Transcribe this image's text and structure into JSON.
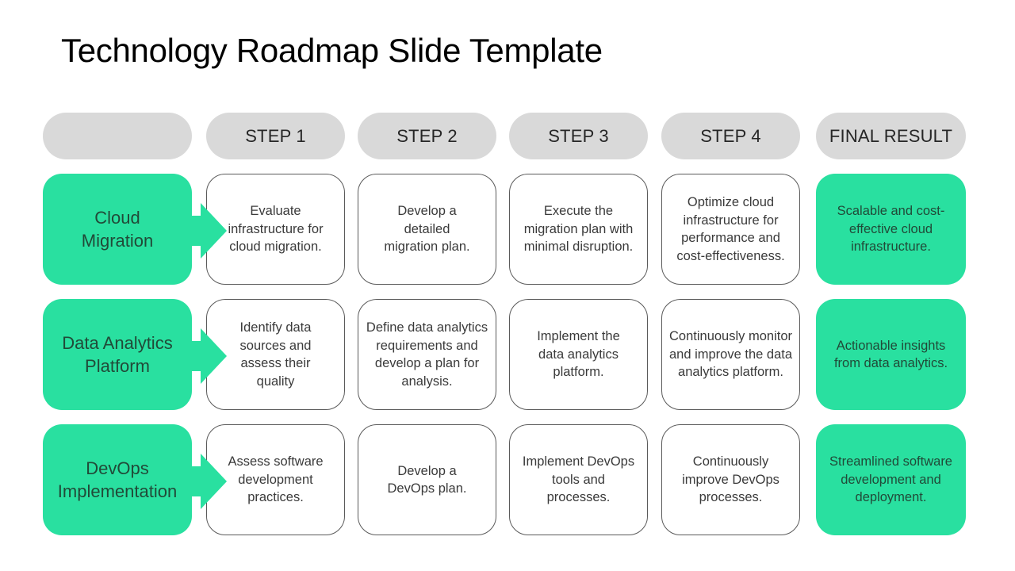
{
  "slide": {
    "title": "Technology Roadmap Slide Template"
  },
  "header": {
    "columns": [
      "",
      "STEP 1",
      "STEP 2",
      "STEP 3",
      "STEP 4",
      "FINAL RESULT"
    ]
  },
  "colors": {
    "accent_green": "#29e0a0",
    "header_gray": "#d9d9d9",
    "border_gray": "#5a5a5a"
  },
  "rows": [
    {
      "category": "Cloud Migration",
      "steps": [
        "Evaluate infrastructure for cloud migration.",
        "Develop a detailed migration plan.",
        "Execute the migration plan with minimal disruption.",
        "Optimize cloud infrastructure for performance and cost-effectiveness."
      ],
      "result": "Scalable and cost-effective cloud infrastructure.",
      "arrow_icon": "right-arrow"
    },
    {
      "category": "Data Analytics Platform",
      "steps": [
        "Identify data sources and assess their quality",
        "Define data analytics requirements and develop a plan for analysis.",
        "Implement the data analytics platform.",
        "Continuously monitor and improve the data analytics platform."
      ],
      "result": "Actionable insights from data analytics.",
      "arrow_icon": "right-arrow"
    },
    {
      "category": "DevOps Implementation",
      "steps": [
        "Assess software development practices.",
        "Develop a DevOps plan.",
        "Implement DevOps tools and processes.",
        "Continuously improve DevOps processes."
      ],
      "result": "Streamlined software development and deployment.",
      "arrow_icon": "right-arrow"
    }
  ]
}
